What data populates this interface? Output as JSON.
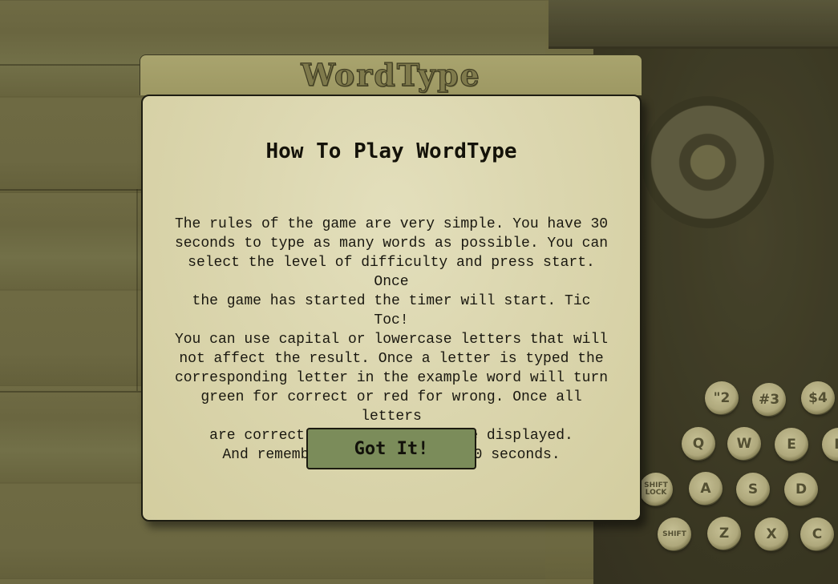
{
  "app": {
    "title": "WordType"
  },
  "modal": {
    "heading": "How To Play WordType",
    "rules_lines": [
      "The rules of the game are very simple. You have 30",
      "seconds to type as many words as possible. You can",
      "select the level of difficulty and press start. Once",
      "the game has started the timer will start. Tic Toc!",
      "You can use capital or lowercase letters that will",
      "not affect the result. Once a letter is typed the",
      "corresponding letter in the example word will turn",
      "green for correct or red for wrong. Once all letters",
      "are correct, a new word will be displayed."
    ],
    "reminder": "And remember, you only have 30 seconds.",
    "confirm_label": "Got It!"
  },
  "background": {
    "typewriter_keys": [
      "\"2",
      "#3",
      "$4",
      "Q",
      "W",
      "E",
      "F",
      "SHIFT LOCK",
      "A",
      "S",
      "D",
      "SHIFT",
      "Z",
      "X",
      "C"
    ]
  },
  "colors": {
    "header_bg": "#a9a46e",
    "modal_bg": "#dcd7b0",
    "button_bg": "#7b8c5a",
    "background_tint": "#6b6840"
  }
}
